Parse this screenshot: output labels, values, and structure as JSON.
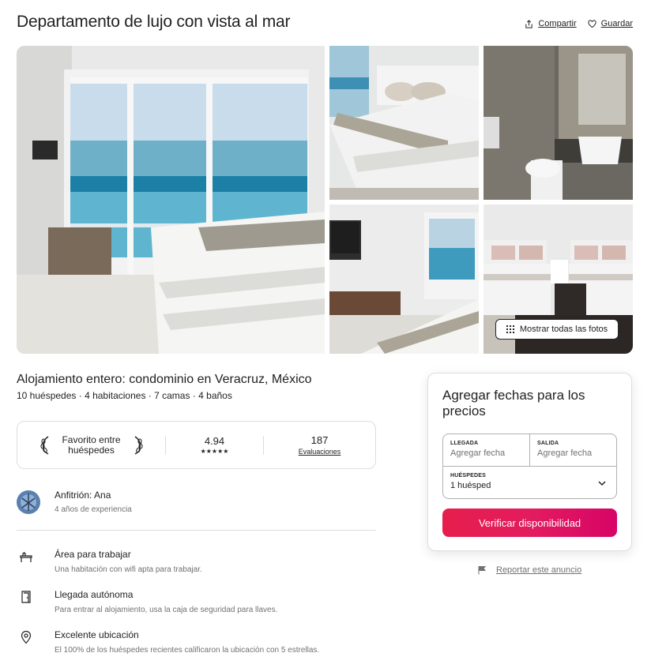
{
  "header": {
    "title": "Departamento de lujo con vista al mar",
    "share_label": "Compartir",
    "save_label": "Guardar"
  },
  "gallery": {
    "show_all_label": "Mostrar todas las fotos",
    "photos": [
      "bedroom-ocean-view",
      "bedroom-bed",
      "bathroom",
      "bedroom-tv",
      "twin-beds"
    ]
  },
  "listing": {
    "subtitle": "Alojamiento entero: condominio en Veracruz, México",
    "stats": "10 huéspedes · 4 habitaciones · 7 camas · 4 baños"
  },
  "favorite": {
    "label": "Favorito entre huéspedes",
    "rating": "4.94",
    "stars": "★★★★★",
    "reviews_count": "187",
    "reviews_label": "Evaluaciones"
  },
  "host": {
    "name": "Anfitrión: Ana",
    "experience": "4 años de experiencia"
  },
  "features": [
    {
      "icon": "desk-icon",
      "title": "Área para trabajar",
      "desc": "Una habitación con wifi apta para trabajar."
    },
    {
      "icon": "door-icon",
      "title": "Llegada autónoma",
      "desc": "Para entrar al alojamiento, usa la caja de seguridad para llaves."
    },
    {
      "icon": "location-pin-icon",
      "title": "Excelente ubicación",
      "desc": "El 100% de los huéspedes recientes calificaron la ubicación con 5 estrellas."
    }
  ],
  "booking": {
    "title": "Agregar fechas para los precios",
    "checkin_label": "LLEGADA",
    "checkin_placeholder": "Agregar fecha",
    "checkout_label": "SALIDA",
    "checkout_placeholder": "Agregar fecha",
    "guests_label": "HUÉSPEDES",
    "guests_value": "1 huésped",
    "cta_label": "Verificar disponibilidad"
  },
  "report": {
    "label": "Reportar este anuncio"
  },
  "colors": {
    "accent": "#e31c5f",
    "text": "#222222",
    "muted": "#717171",
    "border": "#dddddd"
  }
}
